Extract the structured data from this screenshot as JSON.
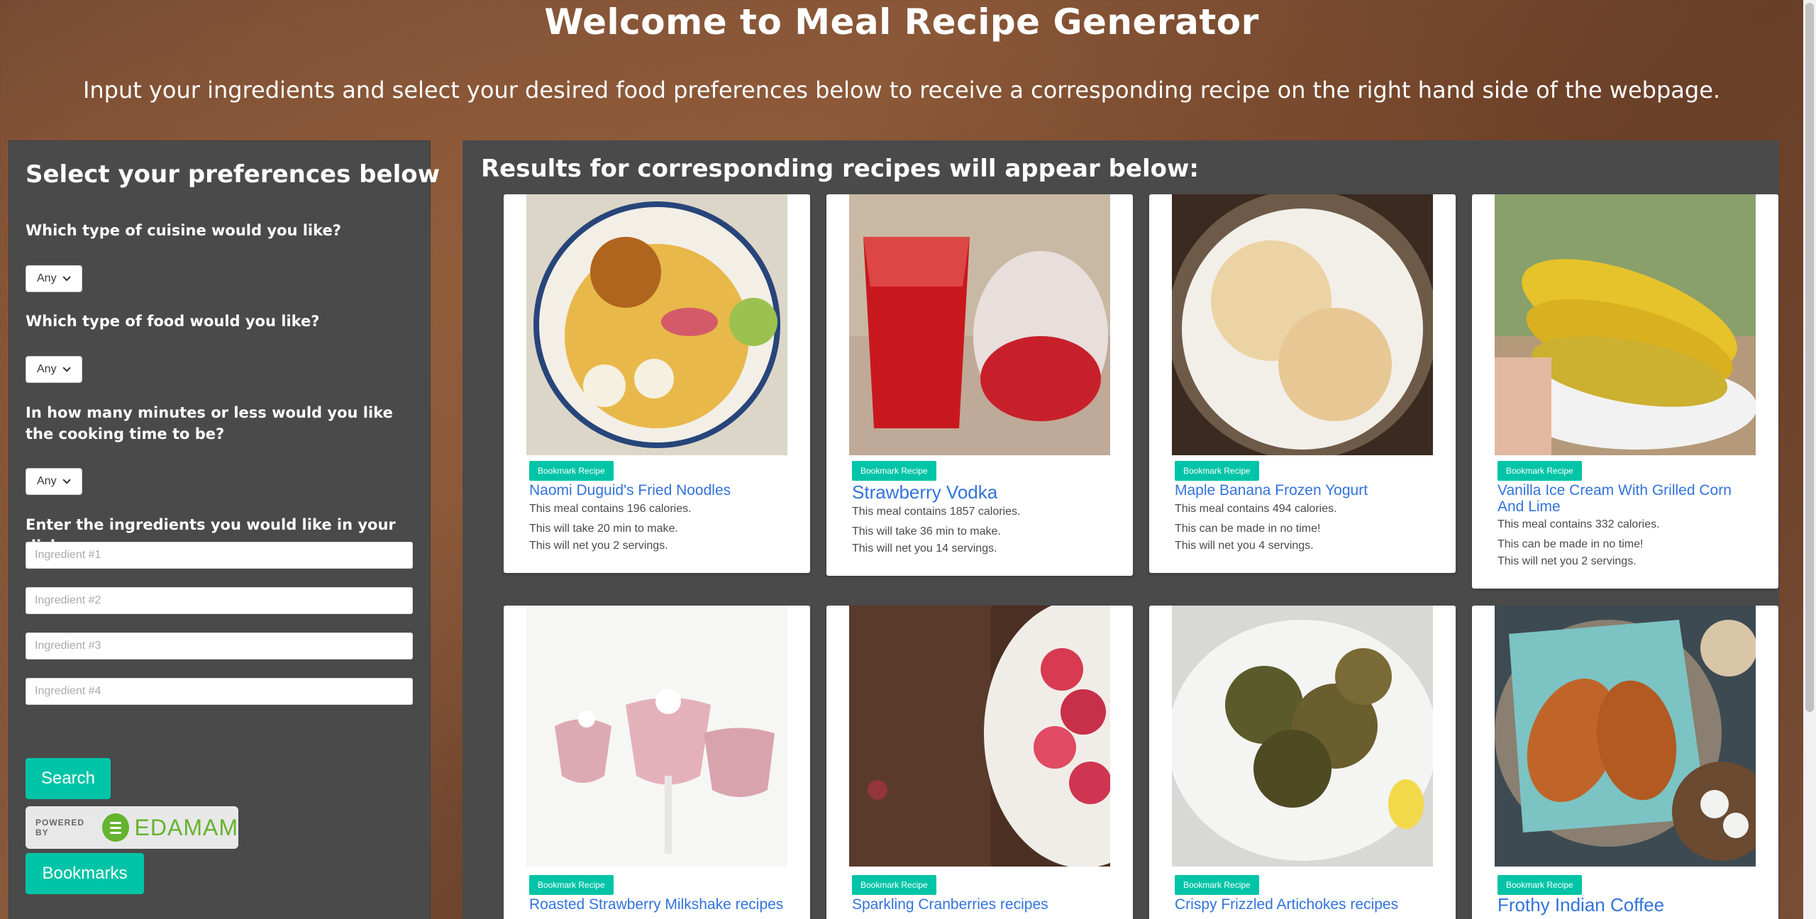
{
  "header": {
    "title": "Welcome to Meal Recipe Generator",
    "subtitle": "Input your ingredients and select your desired food preferences below to receive a corresponding recipe on the right hand side of the webpage."
  },
  "sidebar": {
    "heading": "Select your preferences below",
    "cuisine_question": "Which type of cuisine would you like?",
    "cuisine_value": "Any",
    "food_question": "Which type of food would you like?",
    "food_value": "Any",
    "time_question": "In how many minutes or less would you like the cooking time to be?",
    "time_value": "Any",
    "ingredients_question": "Enter the ingredients you would like in your dish.",
    "ingredients": [
      {
        "placeholder": "Ingredient #1"
      },
      {
        "placeholder": "Ingredient #2"
      },
      {
        "placeholder": "Ingredient #3"
      },
      {
        "placeholder": "Ingredient #4"
      }
    ],
    "search_label": "Search",
    "powered_by": "POWERED BY",
    "edamam": "EDAMAM",
    "bookmarks_label": "Bookmarks"
  },
  "results": {
    "heading": "Results for corresponding recipes will appear below:",
    "bookmark_label": "Bookmark Recipe",
    "cards": [
      {
        "title": "Naomi Duguid's Fried Noodles",
        "calories": "This meal contains 196 calories.",
        "time": "This will take 20 min to make.",
        "servings": "This will net you 2 servings."
      },
      {
        "title": "Strawberry Vodka",
        "calories": "This meal contains 1857 calories.",
        "time": "This will take 36 min to make.",
        "servings": "This will net you 14 servings."
      },
      {
        "title": "Maple Banana Frozen Yogurt",
        "calories": "This meal contains 494 calories.",
        "time": "This can be made in no time!",
        "servings": "This will net you 4 servings."
      },
      {
        "title": "Vanilla Ice Cream With Grilled Corn And Lime",
        "calories": "This meal contains 332 calories.",
        "time": "This can be made in no time!",
        "servings": "This will net you 2 servings."
      },
      {
        "title": "Roasted Strawberry Milkshake recipes"
      },
      {
        "title": "Sparkling Cranberries recipes"
      },
      {
        "title": "Crispy Frizzled Artichokes recipes"
      },
      {
        "title": "Frothy Indian Coffee"
      }
    ]
  }
}
